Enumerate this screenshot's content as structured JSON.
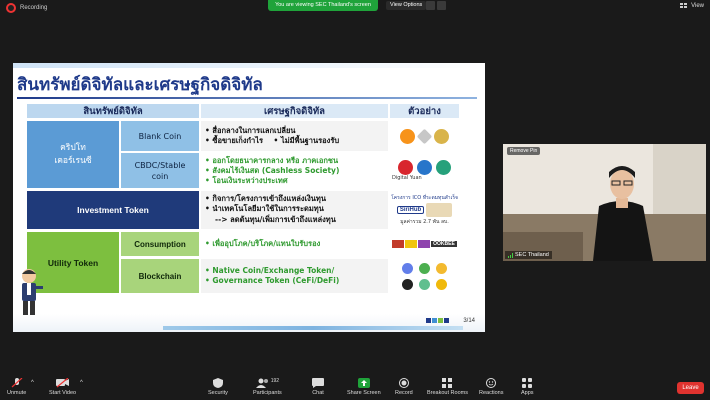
{
  "topbar": {
    "recording_label": "Recording",
    "viewing_banner": "You are viewing SEC Thailand's screen",
    "view_options_label": "View Options",
    "view_menu_label": "View"
  },
  "slide": {
    "title": "สินทรัพย์ดิจิทัลและเศรษฐกิจดิจิทัล",
    "headers": {
      "asset": "สินทรัพย์ดิจิทัล",
      "economy": "เศรษฐกิจดิจิทัล",
      "example": "ตัวอย่าง"
    },
    "crypto": {
      "label": "คริปโท\nเคอร์เรนซี",
      "blank_coin": {
        "label": "Blank Coin",
        "bullets": [
          "สื่อกลางในการแลกเปลี่ยน",
          "ซื้อขายเก็งกำไร",
          "ไม่มีพื้นฐานรองรับ"
        ]
      },
      "cbdc": {
        "label": "CBDC/Stable\ncoin",
        "bullets": [
          "ออกโดยธนาคารกลาง หรือ ภาคเอกชน",
          "สังคมไร้เงินสด (Cashless Society)",
          "โอนเงินระหว่างประเทศ"
        ],
        "example_caption": "Digital Yuan"
      }
    },
    "investment": {
      "label": "Investment Token",
      "bullets": [
        "กิจการ/โครงการเข้าถึงแหล่งเงินทุน",
        "นำเทคโนโลยีมาใช้ในการระดมทุน"
      ],
      "arrow_text": "--> ลดต้นทุน/เพิ่มการเข้าถึงแหล่งทุน",
      "example_caption_top": "โครงการ ICO ที่ระดมทุนสำเร็จ",
      "example_brand": "SiriHub",
      "example_caption_bottom": "มูลค่ารวม 2.7 พัน ลบ."
    },
    "utility": {
      "label": "Utility Token",
      "consumption": {
        "label": "Consumption",
        "bullets": [
          "เพื่ออุปโภค/บริโภค/แทนใบรับรอง"
        ],
        "example_brand": "OOKBEE"
      },
      "blockchain": {
        "label": "Blockchain",
        "bullets": [
          "Native Coin/Exchange Token/",
          "Governance Token (CeFi/DeFi)"
        ]
      }
    },
    "page_number": "3/14"
  },
  "camera": {
    "remove_pin_label": "Remove Pin",
    "participant_name": "SEC Thailand"
  },
  "toolbar": {
    "unmute": "Unmute",
    "start_video": "Start Video",
    "security": "Security",
    "participants": "Participants",
    "participants_count": "192",
    "chat": "Chat",
    "share_screen": "Share Screen",
    "record": "Record",
    "breakout_rooms": "Breakout Rooms",
    "reactions": "Reactions",
    "apps": "Apps",
    "leave": "Leave"
  },
  "colors": {
    "share_green": "#1fa33a",
    "leave_red": "#e0332f",
    "title_blue": "#1f3a8a"
  }
}
